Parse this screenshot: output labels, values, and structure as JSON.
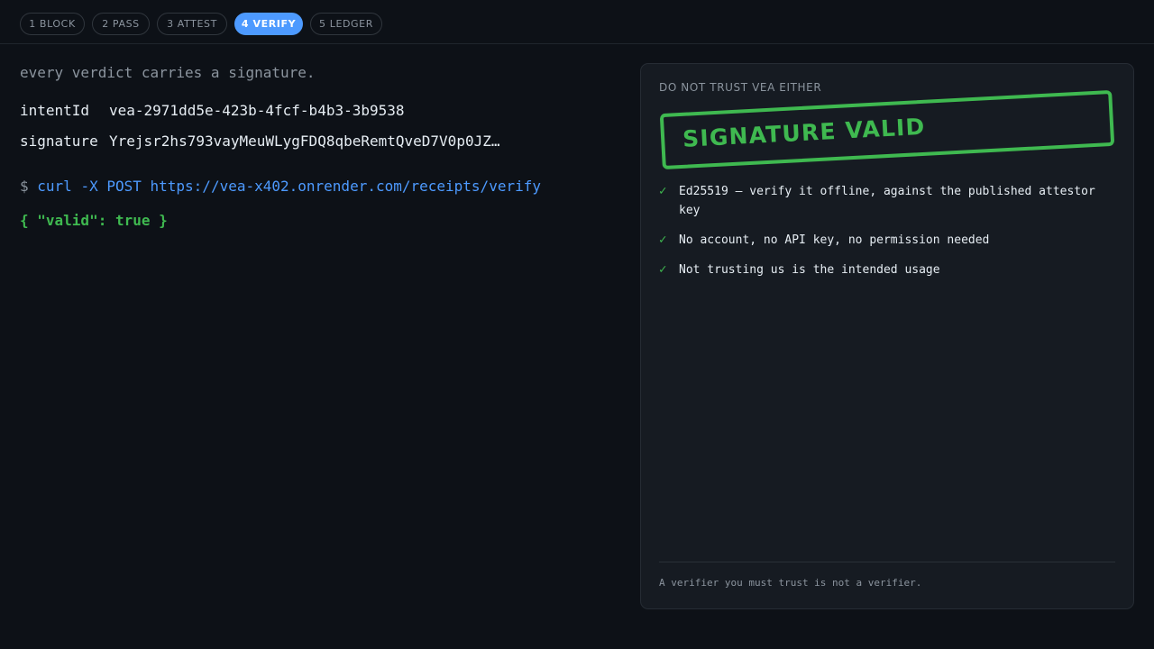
{
  "tabs": [
    {
      "label": "1 BLOCK",
      "active": false
    },
    {
      "label": "2 PASS",
      "active": false
    },
    {
      "label": "3 ATTEST",
      "active": false
    },
    {
      "label": "4 VERIFY",
      "active": true
    },
    {
      "label": "5 LEDGER",
      "active": false
    }
  ],
  "main": {
    "tagline": "every verdict carries a signature.",
    "intent": {
      "key": "intentId",
      "value": "vea-2971dd5e-423b-4fcf-b4b3-3b9538"
    },
    "signature": {
      "key": "signature",
      "value": "Yrejsr2hs793vayMeuWLygFDQ8qbeRemtQveD7V0p0JZ…"
    },
    "command": {
      "prompt": "$",
      "text": "curl -X POST https://vea-x402.onrender.com/receipts/verify"
    },
    "result": "{ \"valid\": true }"
  },
  "panel": {
    "title": "DO NOT TRUST VEA EITHER",
    "stamp": "SIGNATURE VALID",
    "checks": [
      "Ed25519 — verify it offline, against the published attestor key",
      "No account, no API key, no permission needed",
      "Not trusting us is the intended usage"
    ],
    "footer": "A verifier you must trust is not a verifier."
  },
  "colors": {
    "background": "#0d1117",
    "accent": "#4d9aff",
    "success": "#3fb950",
    "muted": "#8b949e"
  }
}
